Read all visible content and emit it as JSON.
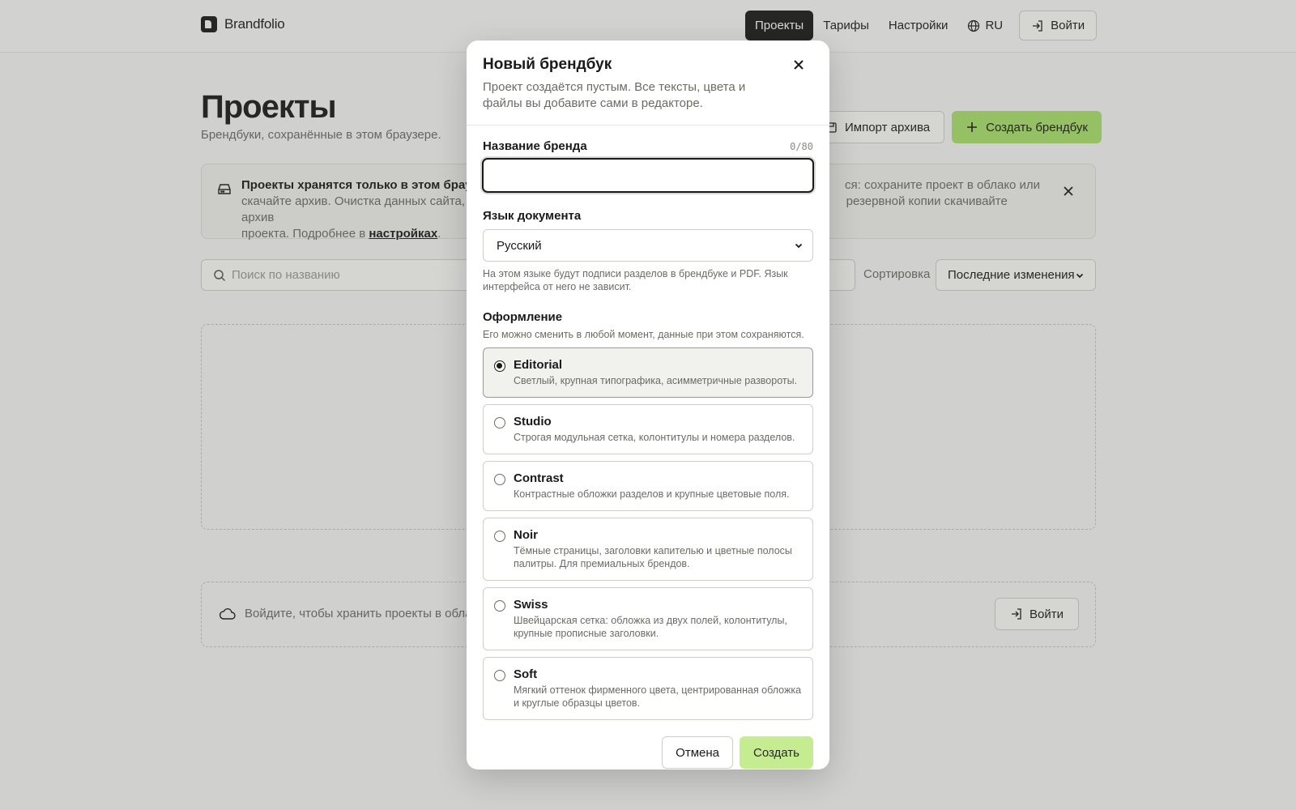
{
  "header": {
    "brand": "Brandfolio",
    "nav": [
      {
        "label": "Проекты",
        "active": true
      },
      {
        "label": "Тарифы",
        "active": false
      },
      {
        "label": "Настройки",
        "active": false
      }
    ],
    "language": "RU",
    "login": "Войти"
  },
  "page": {
    "title": "Проекты",
    "subtitle": "Брендбуки, сохранённые в этом браузере.",
    "import_button": "Импорт архива",
    "create_button": "Создать брендбук"
  },
  "notice": {
    "bold": "Проекты хранятся только в этом браузе",
    "line1_rest": "ся: сохраните проект в облако или",
    "line2_left": "скачайте архив. Очистка данных сайта, пр",
    "line2_right": "резервной копии скачивайте архив",
    "line3_prefix": "проекта. Подробнее в",
    "link": "настройках",
    "line3_suffix": "."
  },
  "toolbar": {
    "search_placeholder": "Поиск по названию",
    "sort_label": "Сортировка",
    "sort_value": "Последние изменения"
  },
  "cloud": {
    "text": "Войдите, чтобы хранить проекты в облаке",
    "login": "Войти"
  },
  "modal": {
    "title": "Новый брендбук",
    "description": "Проект создаётся пустым. Все тексты, цвета и файлы вы добавите сами в редакторе.",
    "name_label": "Название бренда",
    "name_counter": "0/80",
    "name_value": "",
    "language_label": "Язык документа",
    "language_value": "Русский",
    "language_hint": "На этом языке будут подписи разделов в брендбуке и PDF. Язык интерфейса от него не зависит.",
    "theme_label": "Оформление",
    "theme_hint": "Его можно сменить в любой момент, данные при этом сохраняются.",
    "themes": [
      {
        "name": "Editorial",
        "desc": "Светлый, крупная типографика, асимметричные развороты.",
        "selected": true
      },
      {
        "name": "Studio",
        "desc": "Строгая модульная сетка, колонтитулы и номера разделов.",
        "selected": false
      },
      {
        "name": "Contrast",
        "desc": "Контрастные обложки разделов и крупные цветовые поля.",
        "selected": false
      },
      {
        "name": "Noir",
        "desc": "Тёмные страницы, заголовки капителью и цветные полосы палитры. Для премиальных брендов.",
        "selected": false
      },
      {
        "name": "Swiss",
        "desc": "Швейцарская сетка: обложка из двух полей, колонтитулы, крупные прописные заголовки.",
        "selected": false
      },
      {
        "name": "Soft",
        "desc": "Мягкий оттенок фирменного цвета, центрированная обложка и круглые образцы цветов.",
        "selected": false
      }
    ],
    "cancel": "Отмена",
    "create": "Создать"
  },
  "colors": {
    "accent_green": "#a8e16b",
    "create_disabled_green": "#c6ec92",
    "dark": "#1a1a1a"
  }
}
